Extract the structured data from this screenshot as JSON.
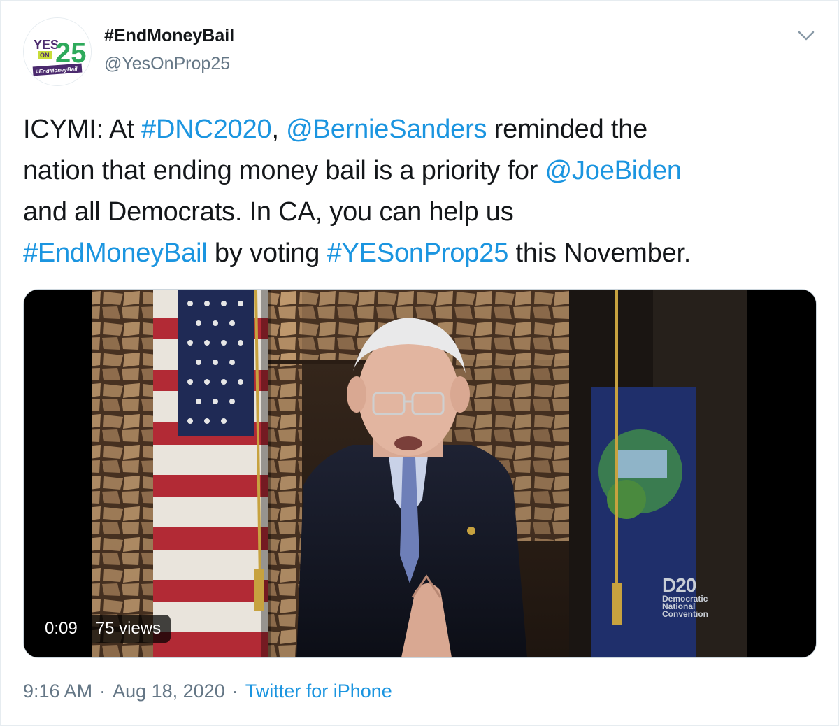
{
  "author": {
    "display_name": "#EndMoneyBail",
    "handle": "@YesOnProp25",
    "avatar_text": {
      "yes": "YES",
      "on": "ON",
      "number": "25",
      "tag": "#EndMoneyBail"
    }
  },
  "menu": {
    "icon": "chevron-down-icon"
  },
  "tweet": {
    "lines": [
      [
        {
          "text": "ICYMI: At ",
          "link": false
        },
        {
          "text": "#DNC2020",
          "link": true
        },
        {
          "text": ", ",
          "link": false
        },
        {
          "text": "@BernieSanders",
          "link": true
        },
        {
          "text": " reminded the",
          "link": false
        }
      ],
      [
        {
          "text": "nation that ending money bail is a priority for ",
          "link": false
        },
        {
          "text": "@JoeBiden",
          "link": true
        }
      ],
      [
        {
          "text": "and all Democrats. In CA, you can help us",
          "link": false
        }
      ],
      [
        {
          "text": "#EndMoneyBail",
          "link": true
        },
        {
          "text": " by voting ",
          "link": false
        },
        {
          "text": "#YESonProp25",
          "link": true
        },
        {
          "text": " this November.",
          "link": false
        }
      ]
    ]
  },
  "video": {
    "duration": "0:09",
    "views": "75 views",
    "watermark": {
      "mark": "D20",
      "lines": [
        "Democratic",
        "National",
        "Convention"
      ]
    }
  },
  "meta": {
    "time": "9:16 AM",
    "separator": "·",
    "date": "Aug 18, 2020",
    "source": "Twitter for iPhone"
  },
  "colors": {
    "link": "#1b95e0",
    "muted": "#657786",
    "text": "#14171a",
    "brand_green": "#2eaa5b",
    "brand_purple": "#4b2a6e"
  }
}
